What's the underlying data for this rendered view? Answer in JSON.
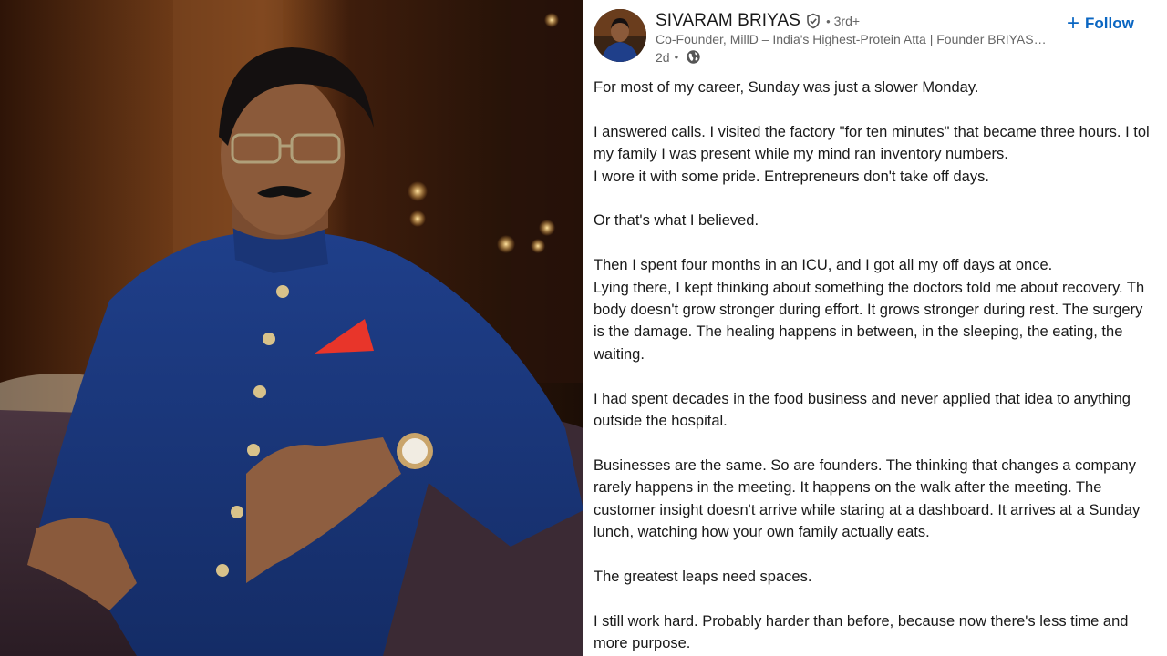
{
  "photo": {
    "description_icon": "portrait-photo"
  },
  "post": {
    "author_name": "SIVARAM BRIYAS",
    "verified_icon": "verified-shield-icon",
    "degree": "3rd+",
    "headline": "Co-Founder, MillD – India's Highest-Protein Atta | Founder BRIYAS…",
    "time": "2d",
    "visibility_icon": "globe-icon",
    "follow_label": "Follow",
    "accent_color": "#0a66c2",
    "paragraphs": [
      [
        "For most of my career, Sunday was just a slower Monday."
      ],
      [
        "I answered calls. I visited the factory \"for ten minutes\" that became three hours. I tol",
        "my family I was present while my mind ran inventory numbers.",
        "I wore it with some pride. Entrepreneurs don't take off days."
      ],
      [
        "Or that's what I believed."
      ],
      [
        "Then I spent four months in an ICU, and I got all my off days at once.",
        "Lying there, I kept thinking about something the doctors told me about recovery. Th",
        "body doesn't grow stronger during effort. It grows stronger during rest. The surgery",
        "is the damage. The healing happens in between, in the sleeping, the eating, the",
        "waiting."
      ],
      [
        "I had spent decades in the food business and never applied that idea to anything",
        "outside the hospital."
      ],
      [
        "Businesses are the same. So are founders. The thinking that changes a company",
        "rarely happens in the meeting. It happens on the walk after the meeting. The",
        "customer insight doesn't arrive while staring at a dashboard. It arrives at a Sunday",
        "lunch, watching how your own family actually eats."
      ],
      [
        "The greatest leaps need spaces."
      ],
      [
        "I still work hard. Probably harder than before, because now there's less time and",
        "more purpose."
      ]
    ]
  }
}
